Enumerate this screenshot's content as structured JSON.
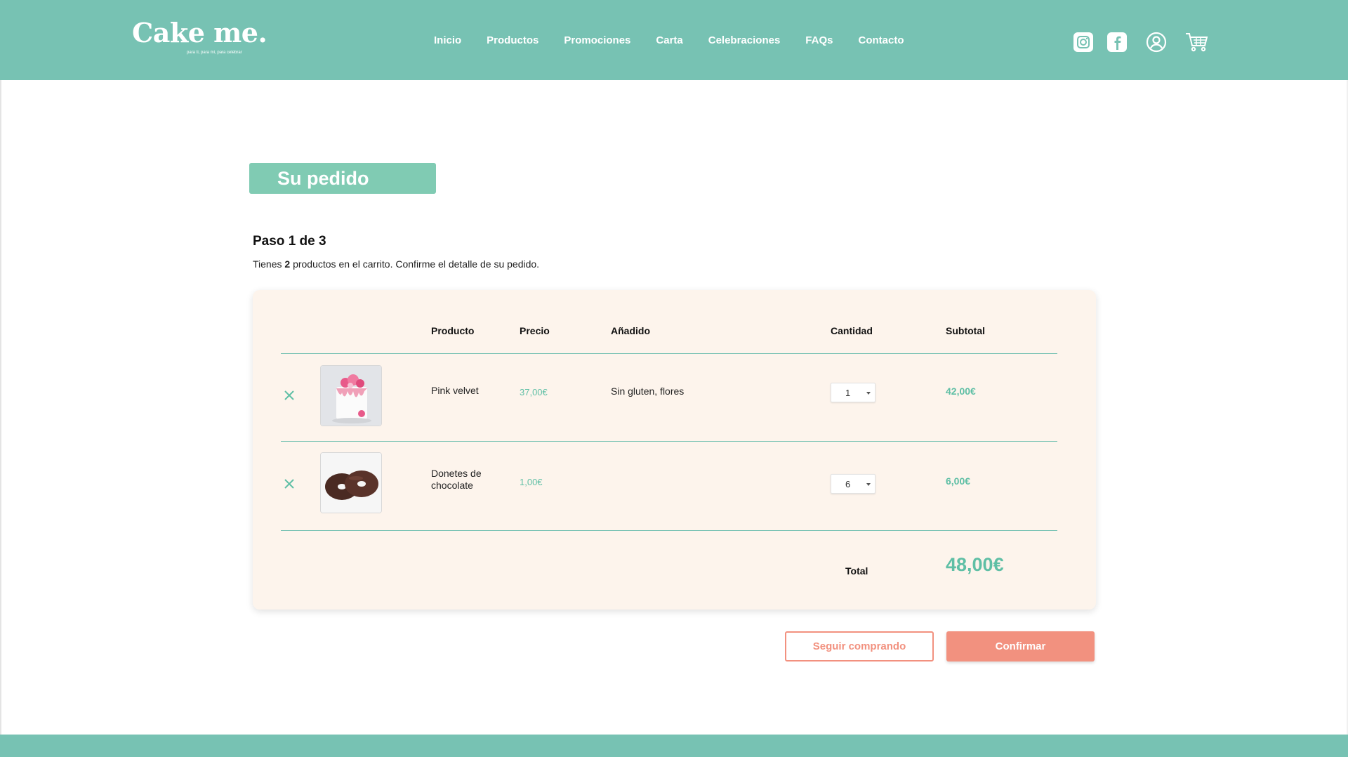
{
  "brand": {
    "logo": "Cake me.",
    "tagline": "para ti, para mi, para celebrar"
  },
  "nav": [
    "Inicio",
    "Productos",
    "Promociones",
    "Carta",
    "Celebraciones",
    "FAQs",
    "Contacto"
  ],
  "header_icons": [
    "instagram-icon",
    "facebook-icon",
    "user-account-icon",
    "shopping-cart-icon"
  ],
  "page": {
    "title": "Su pedido",
    "step": "Paso 1 de 3",
    "summary_prefix": "Tienes ",
    "summary_count": "2",
    "summary_suffix": " productos en el carrito. Confirme el detalle de su pedido."
  },
  "table": {
    "headers": {
      "product": "Producto",
      "price": "Precio",
      "addon": "Añadido",
      "quantity": "Cantidad",
      "subtotal": "Subtotal"
    },
    "rows": [
      {
        "product": "Pink velvet",
        "price": "37,00€",
        "addon": "Sin gluten, flores",
        "quantity": "1",
        "subtotal": "42,00€",
        "image": "pink-velvet-cake-image"
      },
      {
        "product": "Donetes de chocolate",
        "price": "1,00€",
        "addon": "",
        "quantity": "6",
        "subtotal": "6,00€",
        "image": "chocolate-donuts-image"
      }
    ],
    "total_label": "Total",
    "total_value": "48,00€"
  },
  "buttons": {
    "continue": "Seguir comprando",
    "confirm": "Confirmar"
  },
  "colors": {
    "brand_teal": "#77c2b3",
    "accent_green": "#5fbfa5",
    "coral": "#f2917f",
    "card_bg": "#fdf4ec"
  }
}
